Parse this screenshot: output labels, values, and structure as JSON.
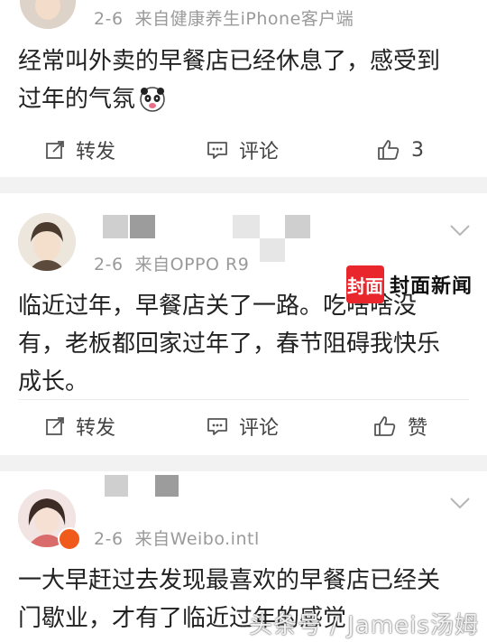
{
  "posts": [
    {
      "date": "2-6",
      "source": "来自健康养生iPhone客户端",
      "text_line1": "经常叫外卖的早餐店已经休息了，感受到",
      "text_line2": "过年的气氛",
      "emoji": "panda-emoji",
      "actions": {
        "repost": "转发",
        "comment": "评论",
        "like": "3"
      }
    },
    {
      "date": "2-6",
      "source": "来自OPPO R9",
      "text_line1": "临近过年，早餐店关了一路。吃啥啥没",
      "text_line2": "有，老板都回家过年了，春节阻碍我快乐",
      "text_line3": "成长。",
      "actions": {
        "repost": "转发",
        "comment": "评论",
        "like": "赞"
      }
    },
    {
      "date": "2-6",
      "source": "来自Weibo.intl",
      "text_line1": "一大早赶过去发现最喜欢的早餐店已经关",
      "text_line2": "门歇业，才有了临近过年的感觉"
    }
  ],
  "logo": {
    "badge": "封面",
    "name": "封面新闻"
  },
  "watermark": "头条号 / Jameis汤姆",
  "colors": {
    "accent_red": "#e8262c",
    "meta_gray": "#9a9a9a",
    "separator": "#f2f2f2"
  }
}
